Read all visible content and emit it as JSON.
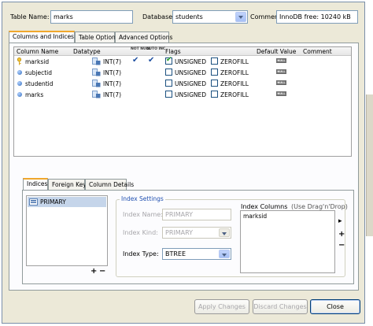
{
  "header": {
    "table_name_label": "Table Name:",
    "table_name_value": "marks",
    "database_label": "Database:",
    "database_value": "students",
    "comment_label": "Comment:",
    "comment_value": "InnoDB free: 10240 kB"
  },
  "main_tabs": [
    {
      "label": "Columns and Indices",
      "active": true
    },
    {
      "label": "Table Options",
      "active": false
    },
    {
      "label": "Advanced Options",
      "active": false
    }
  ],
  "columns_grid": {
    "headers": {
      "name": "Column Name",
      "datatype": "Datatype",
      "not_null": "NOT NULL",
      "auto_inc": "AUTO INC",
      "flags": "Flags",
      "default_value": "Default Value",
      "comment": "Comment"
    },
    "flag_labels": {
      "unsigned": "UNSIGNED",
      "zerofill": "ZEROFILL"
    },
    "null_badge": "NULL",
    "rows": [
      {
        "name": "marksid",
        "type": "INT(7)",
        "primary_key": true,
        "not_null": true,
        "auto_inc": true,
        "unsigned": true,
        "zerofill": false
      },
      {
        "name": "subjectid",
        "type": "INT(7)",
        "primary_key": false,
        "not_null": false,
        "auto_inc": false,
        "unsigned": false,
        "zerofill": false
      },
      {
        "name": "studentid",
        "type": "INT(7)",
        "primary_key": false,
        "not_null": false,
        "auto_inc": false,
        "unsigned": false,
        "zerofill": false
      },
      {
        "name": "marks",
        "type": "INT(7)",
        "primary_key": false,
        "not_null": false,
        "auto_inc": false,
        "unsigned": false,
        "zerofill": false
      }
    ]
  },
  "lower_tabs": [
    {
      "label": "Indices",
      "active": true
    },
    {
      "label": "Foreign Keys",
      "active": false
    },
    {
      "label": "Column Details",
      "active": false
    }
  ],
  "indices": {
    "items": [
      "PRIMARY"
    ],
    "add_symbol": "+",
    "remove_symbol": "−"
  },
  "index_settings": {
    "group_label": "Index Settings",
    "name_label": "Index Name:",
    "name_value": "PRIMARY",
    "kind_label": "Index Kind:",
    "kind_value": "PRIMARY",
    "type_label": "Index Type:",
    "type_value": "BTREE",
    "columns_label": "Index Columns",
    "columns_hint": "(Use Drag'n'Drop)",
    "columns": [
      "marksid"
    ],
    "right_arrow": "▸",
    "add_symbol": "+",
    "remove_symbol": "−"
  },
  "footer": {
    "apply_label": "Apply Changes",
    "discard_label": "Discard Changes",
    "close_label": "Close"
  },
  "colors": {
    "window_bg": "#ece9d8",
    "tab_highlight": "#f0a72c",
    "input_border": "#7f9db9",
    "primary_button_border": "#003c74"
  }
}
